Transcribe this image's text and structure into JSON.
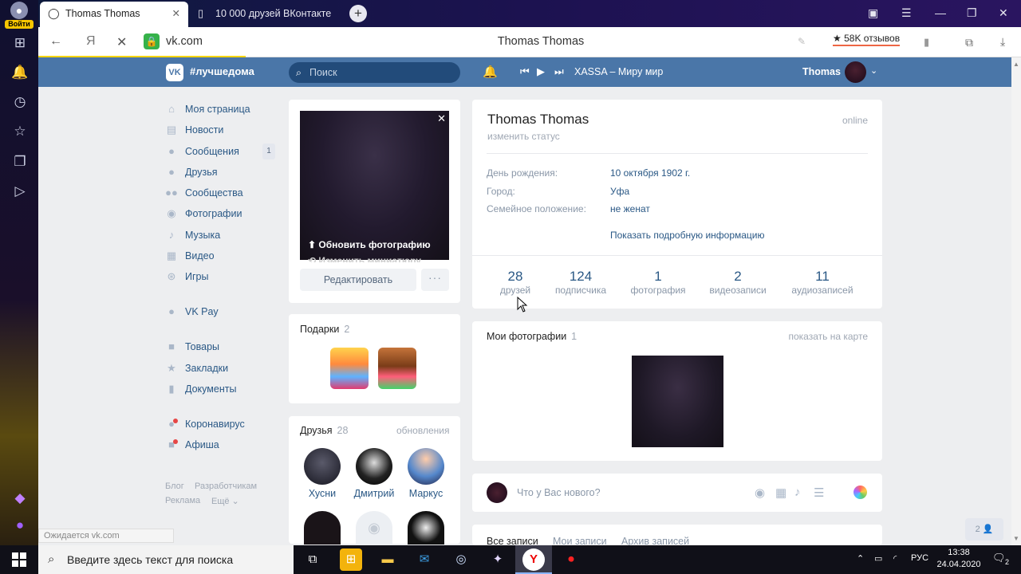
{
  "browser": {
    "login_label": "Войти",
    "tabs": [
      {
        "title": "Thomas Thomas",
        "icon": "loading-icon",
        "close": "✕"
      },
      {
        "title": "10 000 друзей ВКонтакте",
        "icon": "page-icon"
      }
    ],
    "new_tab": "+",
    "address": {
      "host": "vk.com",
      "page_title": "Thomas Thomas",
      "reviews": "★ 58K отзывов"
    }
  },
  "vk": {
    "logo": "VK",
    "slogan": "#лучшедома",
    "search_placeholder": "Поиск",
    "now_playing": "XASSA – Миру мир",
    "user": "Thomas",
    "menu": [
      {
        "label": "Моя страница",
        "icon": "home-icon"
      },
      {
        "label": "Новости",
        "icon": "news-icon"
      },
      {
        "label": "Сообщения",
        "icon": "messages-icon",
        "count": "1"
      },
      {
        "label": "Друзья",
        "icon": "friends-icon"
      },
      {
        "label": "Сообщества",
        "icon": "communities-icon"
      },
      {
        "label": "Фотографии",
        "icon": "camera-icon"
      },
      {
        "label": "Музыка",
        "icon": "music-icon"
      },
      {
        "label": "Видео",
        "icon": "video-icon"
      },
      {
        "label": "Игры",
        "icon": "gamepad-icon"
      },
      {
        "label": "VK Pay",
        "icon": "vkpay-icon"
      },
      {
        "label": "Товары",
        "icon": "bag-icon"
      },
      {
        "label": "Закладки",
        "icon": "star-icon"
      },
      {
        "label": "Документы",
        "icon": "document-icon"
      },
      {
        "label": "Коронавирус",
        "icon": "virus-icon"
      },
      {
        "label": "Афиша",
        "icon": "poster-icon"
      }
    ],
    "footer_links": [
      "Блог",
      "Разработчикам",
      "Реклама",
      "Ещё ⌄"
    ],
    "avatar_actions": {
      "update_photo": "Обновить фотографию",
      "update_thumb": "Изменить миниатюру",
      "edit": "Редактировать",
      "more": "···"
    },
    "gifts": {
      "title": "Подарки",
      "count": "2"
    },
    "friends_block": {
      "title": "Друзья",
      "count": "28",
      "updates": "обновления",
      "names": [
        "Хусни",
        "Дмитрий",
        "Маркус"
      ]
    },
    "profile": {
      "name": "Thomas Thomas",
      "status": "изменить статус",
      "online": "online",
      "fields": [
        {
          "label": "День рождения:",
          "value": "10 октября 1902 г."
        },
        {
          "label": "Город:",
          "value": "Уфа"
        },
        {
          "label": "Семейное положение:",
          "value": "не женат"
        }
      ],
      "more_info": "Показать подробную информацию",
      "counters": [
        {
          "value": "28",
          "label": "друзей"
        },
        {
          "value": "124",
          "label": "подписчика"
        },
        {
          "value": "1",
          "label": "фотография"
        },
        {
          "value": "2",
          "label": "видеозаписи"
        },
        {
          "value": "11",
          "label": "аудиозаписей"
        }
      ]
    },
    "photos_block": {
      "title": "Мои фотографии",
      "count": "1",
      "map_link": "показать на карте"
    },
    "compose_placeholder": "Что у Вас нового?",
    "wall_tabs": [
      "Все записи",
      "Мои записи",
      "Архив записей"
    ],
    "online_friends_badge": "2 👤",
    "status_bar": "Ожидается vk.com"
  },
  "taskbar": {
    "search_placeholder": "Введите здесь текст для поиска",
    "language": "РУС",
    "time": "13:38",
    "date": "24.04.2020",
    "notifications": "2"
  }
}
